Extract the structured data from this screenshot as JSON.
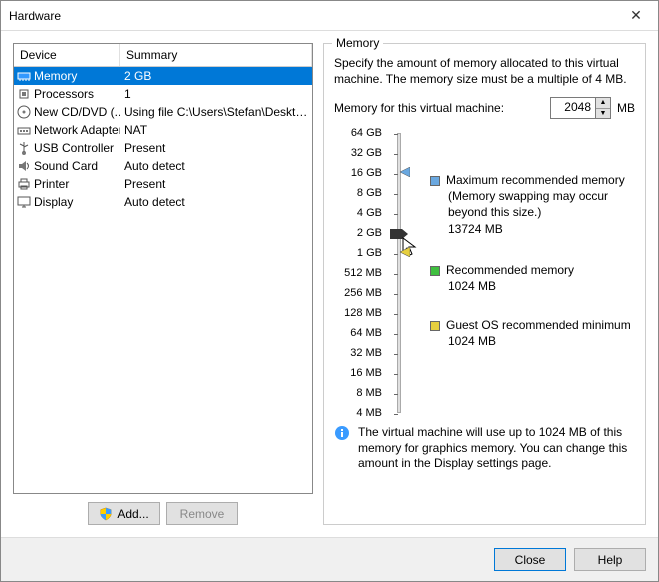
{
  "title": "Hardware",
  "columns": {
    "device": "Device",
    "summary": "Summary"
  },
  "devices": [
    {
      "name": "Memory",
      "summary": "2 GB",
      "icon": "memory"
    },
    {
      "name": "Processors",
      "summary": "1",
      "icon": "cpu"
    },
    {
      "name": "New CD/DVD (...",
      "summary": "Using file C:\\Users\\Stefan\\Deskto...",
      "icon": "disc"
    },
    {
      "name": "Network Adapter",
      "summary": "NAT",
      "icon": "net"
    },
    {
      "name": "USB Controller",
      "summary": "Present",
      "icon": "usb"
    },
    {
      "name": "Sound Card",
      "summary": "Auto detect",
      "icon": "sound"
    },
    {
      "name": "Printer",
      "summary": "Present",
      "icon": "printer"
    },
    {
      "name": "Display",
      "summary": "Auto detect",
      "icon": "display"
    }
  ],
  "selected_index": 0,
  "buttons": {
    "add": "Add...",
    "remove": "Remove",
    "close": "Close",
    "help": "Help"
  },
  "memory": {
    "group": "Memory",
    "desc": "Specify the amount of memory allocated to this virtual machine. The memory size must be a multiple of 4 MB.",
    "input_label": "Memory for this virtual machine:",
    "value": "2048",
    "unit": "MB",
    "ticks": [
      "64 GB",
      "32 GB",
      "16 GB",
      "8 GB",
      "4 GB",
      "2 GB",
      "1 GB",
      "512 MB",
      "256 MB",
      "128 MB",
      "64 MB",
      "32 MB",
      "16 MB",
      "8 MB",
      "4 MB"
    ],
    "thumb_index": 5,
    "markers": {
      "max": {
        "index": 2,
        "color": "#6aa8e0",
        "label": "Maximum recommended memory",
        "note": "(Memory swapping may occur beyond this size.)",
        "value": "13724 MB"
      },
      "rec": {
        "index": 6,
        "color": "#3fbf3f",
        "label": "Recommended memory",
        "value": "1024 MB"
      },
      "guest": {
        "index": 6,
        "color": "#e6cf3f",
        "label": "Guest OS recommended minimum",
        "value": "1024 MB"
      }
    },
    "info": "The virtual machine will use up to 1024 MB of this memory for graphics memory. You can change this amount in the Display settings page."
  }
}
